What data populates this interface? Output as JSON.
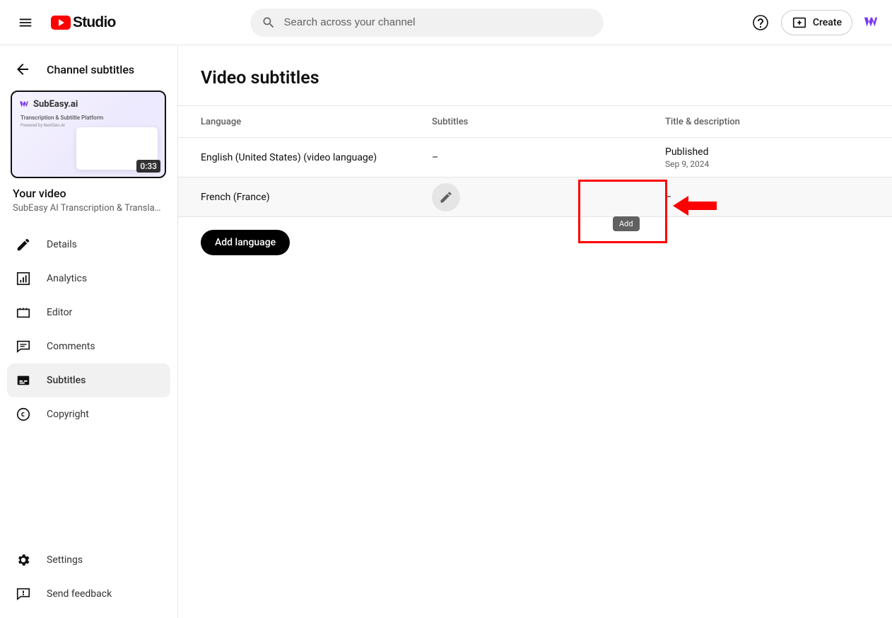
{
  "header": {
    "logo_text": "Studio",
    "search_placeholder": "Search across your channel",
    "create_label": "Create"
  },
  "sidebar": {
    "back_title": "Channel subtitles",
    "video_label": "Your video",
    "video_title": "SubEasy AI Transcription & Translati…",
    "thumb_brand": "SubEasy.ai",
    "thumb_sub": "Transcription & Subtitle Platform",
    "thumb_sub2": "Powered by NextGen.AI",
    "thumb_duration": "0:33",
    "nav": [
      {
        "label": "Details",
        "icon": "pencil"
      },
      {
        "label": "Analytics",
        "icon": "analytics"
      },
      {
        "label": "Editor",
        "icon": "editor"
      },
      {
        "label": "Comments",
        "icon": "comments"
      },
      {
        "label": "Subtitles",
        "icon": "subtitles"
      },
      {
        "label": "Copyright",
        "icon": "copyright"
      }
    ],
    "bottom": [
      {
        "label": "Settings",
        "icon": "settings"
      },
      {
        "label": "Send feedback",
        "icon": "feedback"
      }
    ]
  },
  "main": {
    "page_title": "Video subtitles",
    "cols": {
      "language": "Language",
      "subtitles": "Subtitles",
      "title": "Title & description"
    },
    "rows": [
      {
        "language": "English (United States) (video language)",
        "subtitles": "–",
        "title_status": "Published",
        "title_date": "Sep 9, 2024"
      },
      {
        "language": "French (France)",
        "subtitles": "",
        "title_status": "–",
        "title_date": ""
      }
    ],
    "tooltip": "Add",
    "add_language_label": "Add language"
  }
}
